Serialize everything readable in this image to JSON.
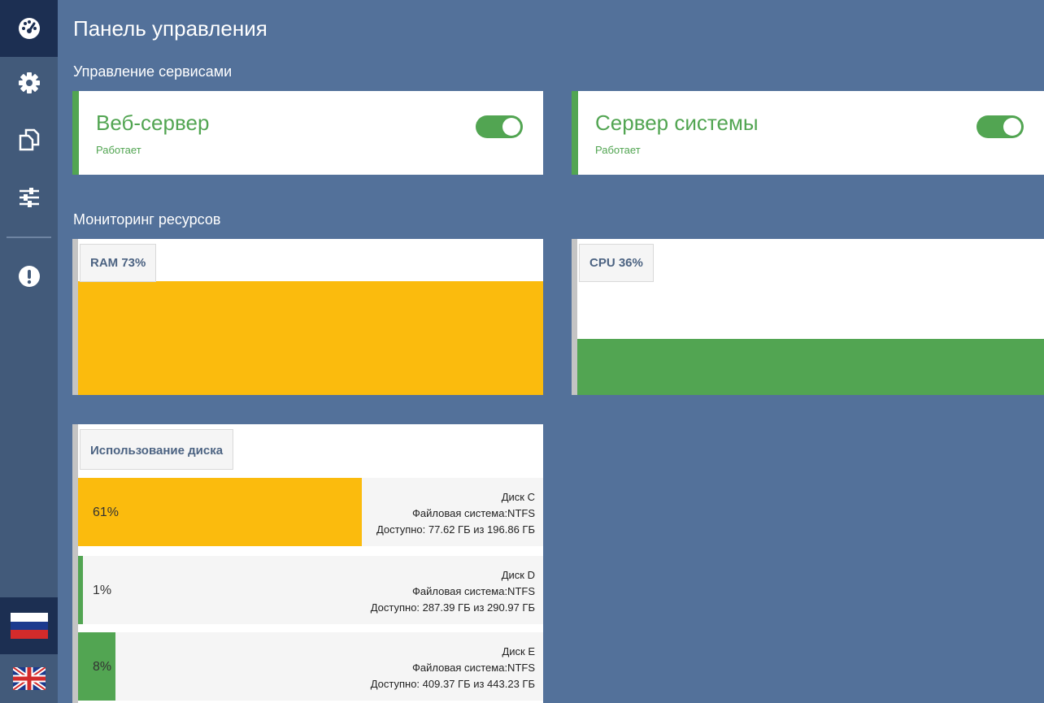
{
  "app": {
    "title": "Панель управления"
  },
  "colors": {
    "ok": "#52a552",
    "warn": "#fbbb0d",
    "sidebar": "#425a7a",
    "sidebar_active": "#1c2f52",
    "background": "#53719a"
  },
  "sidebar": {
    "items": [
      {
        "icon": "dashboard-icon"
      },
      {
        "icon": "gear-icon"
      },
      {
        "icon": "copy-icon"
      },
      {
        "icon": "sliders-icon"
      },
      {
        "icon": "alert-icon"
      }
    ],
    "languages": [
      {
        "icon": "flag-russia-icon"
      },
      {
        "icon": "flag-uk-icon"
      }
    ]
  },
  "services": {
    "title": "Управление сервисами",
    "items": [
      {
        "name": "Веб-сервер",
        "status": "Работает",
        "enabled": true
      },
      {
        "name": "Сервер системы",
        "status": "Работает",
        "enabled": true
      }
    ]
  },
  "monitoring": {
    "title": "Мониторинг ресурсов",
    "ram": {
      "label": "RAM 73%",
      "percent": 73
    },
    "cpu": {
      "label": "CPU 36%",
      "percent": 36
    }
  },
  "disks": {
    "title": "Использование диска",
    "items": [
      {
        "percent_label": "61%",
        "percent": 61,
        "name": "Диск C",
        "fs": "Файловая система:NTFS",
        "available": "Доступно: 77.62 ГБ из 196.86 ГБ"
      },
      {
        "percent_label": "1%",
        "percent": 1,
        "name": "Диск D",
        "fs": "Файловая система:NTFS",
        "available": "Доступно: 287.39 ГБ из 290.97 ГБ"
      },
      {
        "percent_label": "8%",
        "percent": 8,
        "name": "Диск E",
        "fs": "Файловая система:NTFS",
        "available": "Доступно: 409.37 ГБ из 443.23 ГБ"
      }
    ]
  }
}
